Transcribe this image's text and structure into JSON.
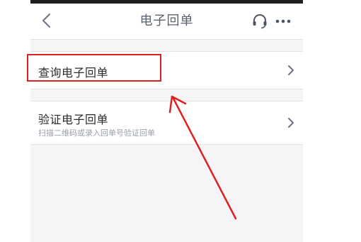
{
  "nav": {
    "title": "电子回单",
    "back_icon": "back-arrow-icon",
    "support_icon": "headset-icon",
    "more_icon": "more-dots-icon"
  },
  "items": [
    {
      "label": "查询电子回单",
      "sub": ""
    },
    {
      "label": "验证电子回单",
      "sub": "扫描二维码或录入回单号验证回单"
    }
  ],
  "colors": {
    "annotation": "#e02020",
    "background": "#f5f5f7",
    "title": "#5b6270"
  }
}
